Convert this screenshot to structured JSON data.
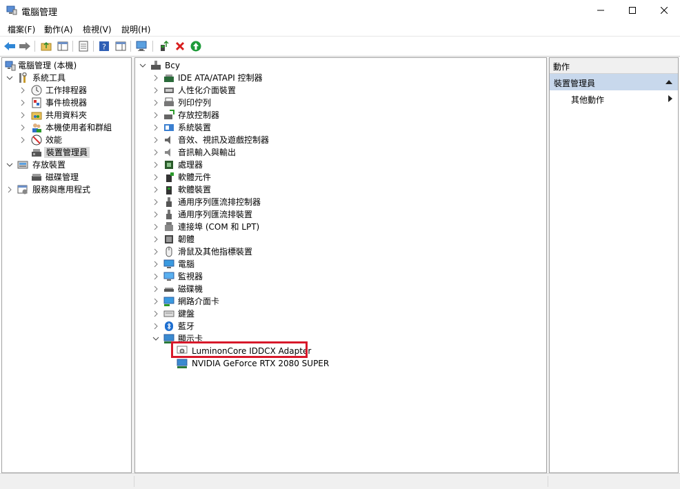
{
  "window": {
    "title": "電腦管理"
  },
  "menubar": {
    "items": [
      "檔案(F)",
      "動作(A)",
      "檢視(V)",
      "說明(H)"
    ]
  },
  "left_tree": {
    "root": "電腦管理 (本機)",
    "system_tools": "系統工具",
    "task_scheduler": "工作排程器",
    "event_viewer": "事件檢視器",
    "shared_folders": "共用資料夾",
    "local_users": "本機使用者和群組",
    "performance": "效能",
    "device_manager": "裝置管理員",
    "storage": "存放裝置",
    "disk_management": "磁碟管理",
    "services_apps": "服務與應用程式"
  },
  "device_tree": {
    "root": "Bcy",
    "categories": [
      "IDE ATA/ATAPI 控制器",
      "人性化介面裝置",
      "列印佇列",
      "存放控制器",
      "系統裝置",
      "音效、視訊及遊戲控制器",
      "音訊輸入與輸出",
      "處理器",
      "軟體元件",
      "軟體裝置",
      "通用序列匯流排控制器",
      "通用序列匯流排裝置",
      "連接埠 (COM 和 LPT)",
      "韌體",
      "滑鼠及其他指標裝置",
      "電腦",
      "監視器",
      "磁碟機",
      "網路介面卡",
      "鍵盤",
      "藍牙",
      "顯示卡"
    ],
    "display_adapters": [
      "LuminonCore IDDCX Adapter",
      "NVIDIA GeForce RTX 2080 SUPER"
    ]
  },
  "actions": {
    "header": "動作",
    "section": "裝置管理員",
    "more": "其他動作"
  },
  "colors": {
    "highlight_border": "#d7182a",
    "selected_section": "#c8d8ec",
    "selected_row": "#d9d9d9"
  }
}
